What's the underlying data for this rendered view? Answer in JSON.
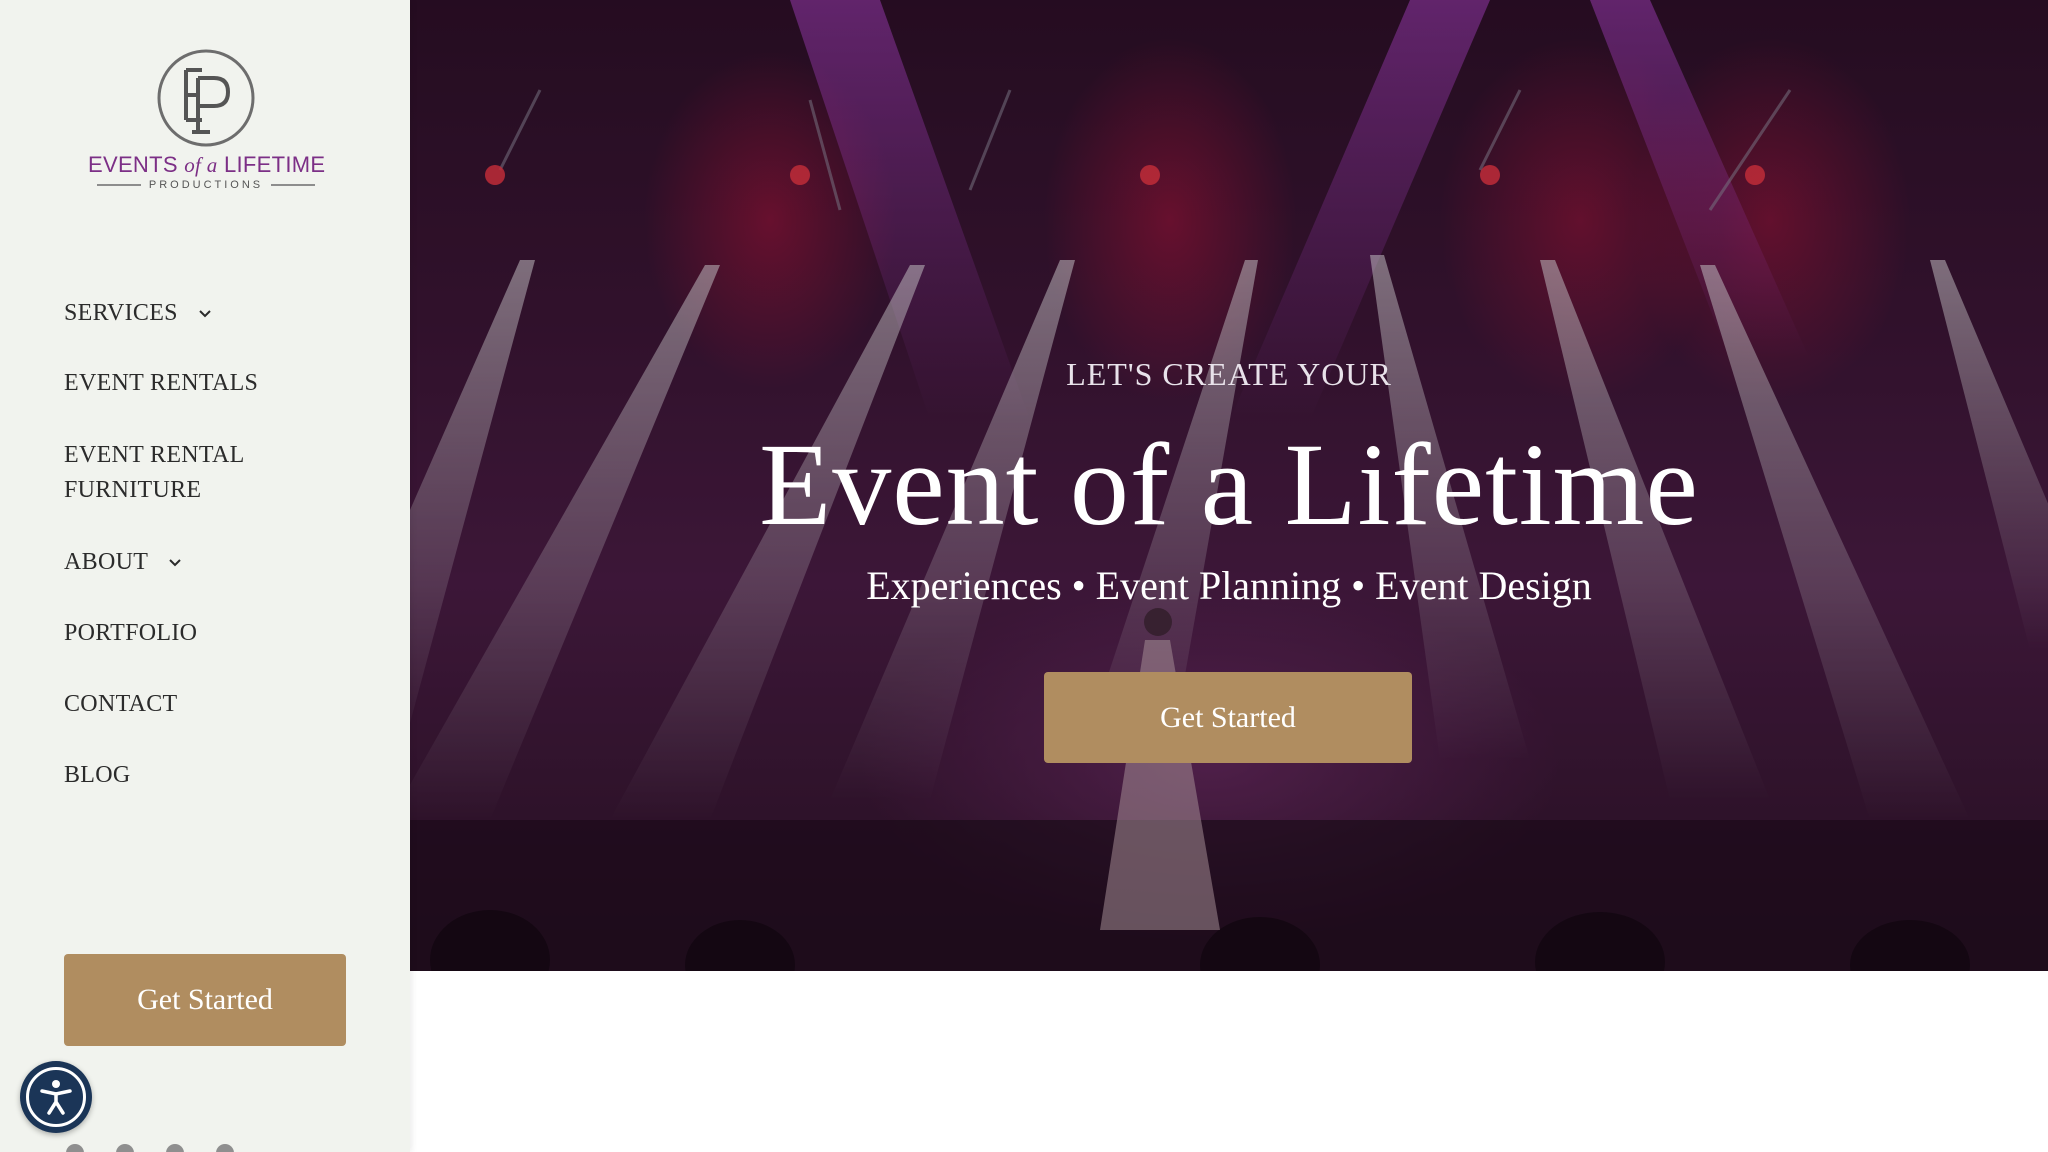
{
  "brand": {
    "monogram": "EP",
    "name_part1": "EVENTS",
    "name_ofa": "of a",
    "name_part2": "LIFETIME",
    "tagline": "PRODUCTIONS",
    "colors": {
      "brand_purple": "#7c2f86",
      "accent_gold": "#b08d60",
      "sidebar_bg": "#f1f3ee",
      "a11y_blue": "#1b3557"
    }
  },
  "sidebar": {
    "nav": [
      {
        "label": "SERVICES",
        "has_dropdown": true,
        "icon": "chevron-down-icon"
      },
      {
        "label": "EVENT RENTALS",
        "has_dropdown": false
      },
      {
        "label": "EVENT RENTAL FURNITURE",
        "has_dropdown": false
      },
      {
        "label": "ABOUT",
        "has_dropdown": true,
        "icon": "chevron-down-icon"
      },
      {
        "label": "PORTFOLIO",
        "has_dropdown": false
      },
      {
        "label": "CONTACT",
        "has_dropdown": false
      },
      {
        "label": "BLOG",
        "has_dropdown": false
      }
    ],
    "cta_label": "Get Started",
    "accessibility_icon": "accessibility-icon",
    "social_icons": [
      "facebook-icon",
      "twitter-icon",
      "instagram-icon",
      "pinterest-icon"
    ]
  },
  "hero": {
    "kicker": "LET'S CREATE YOUR",
    "headline": "Event of a Lifetime",
    "subline": "Experiences • Event Planning • Event Design",
    "cta_label": "Get Started",
    "background": "concert-stage-photo"
  }
}
